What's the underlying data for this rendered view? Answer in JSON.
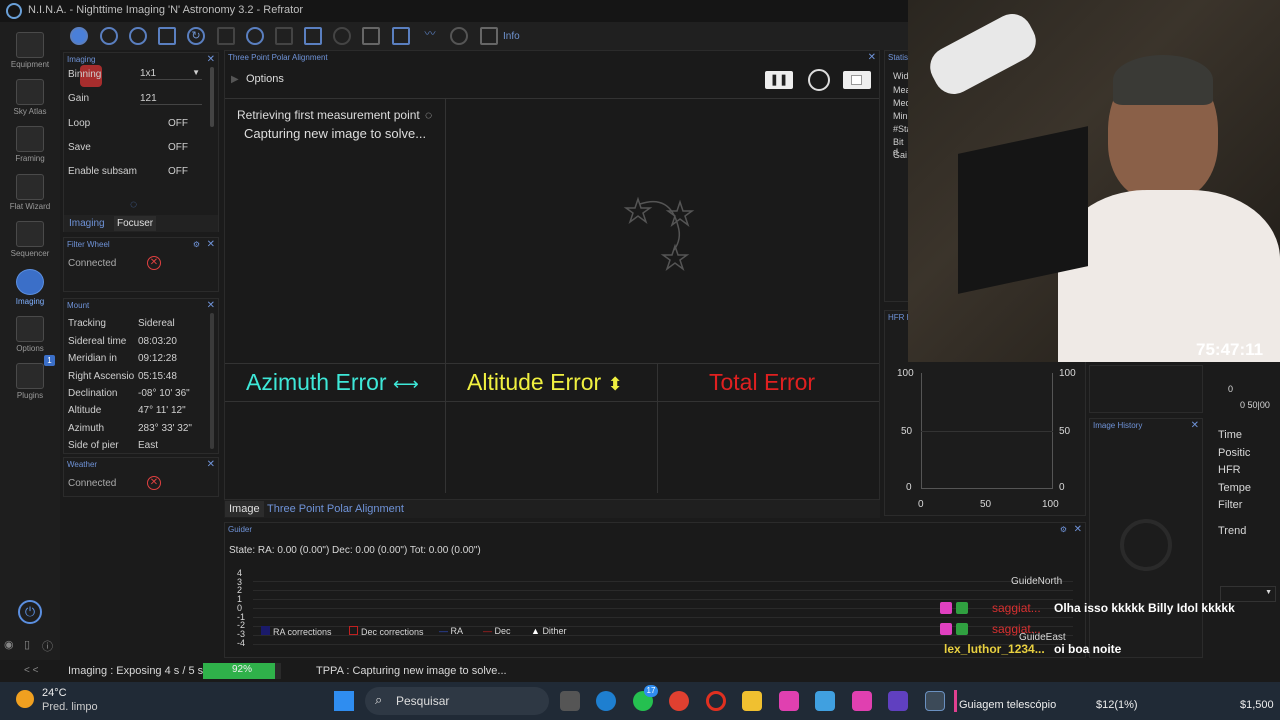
{
  "app": {
    "title": "N.I.N.A. - Nighttime Imaging 'N' Astronomy 3.2  -  Refrator"
  },
  "sidebar": {
    "items": [
      {
        "label": "Equipment"
      },
      {
        "label": "Sky Atlas"
      },
      {
        "label": "Framing"
      },
      {
        "label": "Flat Wizard"
      },
      {
        "label": "Sequencer"
      },
      {
        "label": "Imaging"
      },
      {
        "label": "Options"
      },
      {
        "label": "Plugins"
      }
    ],
    "plugins_badge": "1"
  },
  "toolbar": {
    "info_label": "Info"
  },
  "imaging_panel": {
    "title": "Imaging",
    "rows": [
      {
        "label": "Binning",
        "value": "1x1"
      },
      {
        "label": "Gain",
        "value": "121"
      },
      {
        "label": "Loop",
        "value": "OFF"
      },
      {
        "label": "Save",
        "value": "OFF"
      },
      {
        "label": "Enable subsam",
        "value": "OFF"
      }
    ],
    "tabs": [
      "Imaging",
      "Focuser"
    ]
  },
  "filter_wheel": {
    "title": "Filter Wheel",
    "status": "Connected"
  },
  "mount": {
    "title": "Mount",
    "rows": [
      {
        "label": "Tracking",
        "value": "Sidereal"
      },
      {
        "label": "Sidereal time",
        "value": "08:03:20"
      },
      {
        "label": "Meridian in",
        "value": "09:12:28"
      },
      {
        "label": "Right Ascensio",
        "value": "05:15:48"
      },
      {
        "label": "Declination",
        "value": "-08° 10' 36\""
      },
      {
        "label": "Altitude",
        "value": "47° 11' 12\""
      },
      {
        "label": "Azimuth",
        "value": "283° 33' 32\""
      },
      {
        "label": "Side of pier",
        "value": "East"
      }
    ]
  },
  "weather": {
    "title": "Weather",
    "status": "Connected"
  },
  "tppa": {
    "title": "Three Point Polar Alignment",
    "options_label": "Options",
    "status1": "Retrieving first measurement point",
    "status2": "Capturing new image to solve...",
    "azimuth_error": "Azimuth Error",
    "altitude_error": "Altitude Error",
    "total_error": "Total Error",
    "azimuth_arrow": "⟷",
    "altitude_arrow": "⬍",
    "tabs": [
      "Image",
      "Three Point Polar Alignment"
    ],
    "colors": {
      "azimuth": "#3ee8d8",
      "altitude": "#f0f040",
      "total": "#e02020"
    }
  },
  "statistics": {
    "title": "Statisti",
    "rows": [
      "Wid",
      "Mea",
      "Med",
      "Min",
      "#Sta",
      "Bit d",
      "Gai"
    ]
  },
  "hfr": {
    "title": "HFR h",
    "y_ticks": [
      "100",
      "50",
      "0"
    ],
    "x_ticks": [
      "0",
      "50",
      "100"
    ],
    "y_right": [
      "100",
      "50",
      "0"
    ]
  },
  "image_history": {
    "title": "Image History"
  },
  "right_cols": {
    "rows": [
      "Time",
      "Positic",
      "HFR",
      "Tempe",
      "Filter",
      "Trend"
    ],
    "axis_zero": "0",
    "axis_ticks": "0 50|00"
  },
  "guider": {
    "title": "Guider",
    "state": "State:  RA: 0.00 (0.00\")  Dec: 0.00 (0.00\")  Tot: 0.00 (0.00\")",
    "y_ticks": [
      "4",
      "3",
      "2",
      "1",
      "0",
      "-1",
      "-2",
      "-3",
      "-4"
    ],
    "guide_north": "GuideNorth",
    "guide_east": "GuideEast",
    "legend": [
      "RA corrections",
      "Dec corrections",
      "RA",
      "Dec",
      "Dither"
    ]
  },
  "chat": [
    {
      "user": "saggiat...",
      "msg": "Olha isso kkkkk Billy Idol kkkkk"
    },
    {
      "user": "saggiat...",
      "msg": ""
    },
    {
      "user": "lex_luthor_1234...",
      "msg": "oi boa noite"
    }
  ],
  "stream_timer": "75:47:11",
  "statusbar": {
    "collapse": "< <",
    "imaging_status": "Imaging :  Exposing 4 s / 5 s",
    "progress": 0.92,
    "progress_label": "92%",
    "tppa_status": "TPPA :  Capturing new image to solve..."
  },
  "taskbar": {
    "temp": "24°C",
    "weather": "Pred. limpo",
    "search": "Pesquisar",
    "whatsapp_badge": "17",
    "app_label": "Guiagem telescópio",
    "stock1": "$12(1%)",
    "stock2": "$1,500"
  }
}
